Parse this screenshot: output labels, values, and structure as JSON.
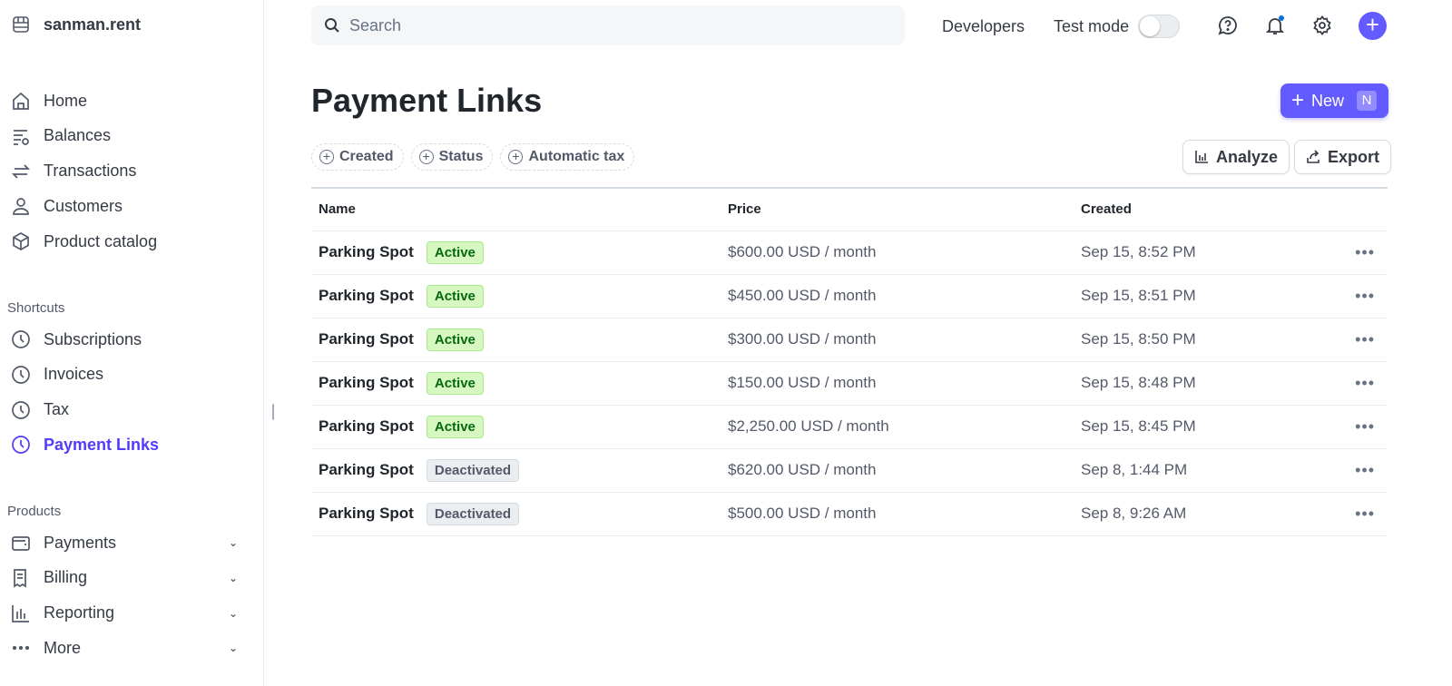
{
  "sidebar": {
    "account": "sanman.rent",
    "main": [
      {
        "label": "Home",
        "icon": "home-icon"
      },
      {
        "label": "Balances",
        "icon": "balances-icon"
      },
      {
        "label": "Transactions",
        "icon": "transactions-icon"
      },
      {
        "label": "Customers",
        "icon": "customer-icon"
      },
      {
        "label": "Product catalog",
        "icon": "box-icon"
      }
    ],
    "shortcuts_title": "Shortcuts",
    "shortcuts": [
      {
        "label": "Subscriptions"
      },
      {
        "label": "Invoices"
      },
      {
        "label": "Tax"
      },
      {
        "label": "Payment Links",
        "active": true
      }
    ],
    "products_title": "Products",
    "products": [
      {
        "label": "Payments"
      },
      {
        "label": "Billing"
      },
      {
        "label": "Reporting"
      },
      {
        "label": "More"
      }
    ]
  },
  "topbar": {
    "search_placeholder": "Search",
    "developers": "Developers",
    "test_mode": "Test mode",
    "test_mode_on": false
  },
  "page": {
    "title": "Payment Links",
    "new_label": "New",
    "new_shortcut": "N",
    "analyze": "Analyze",
    "export": "Export",
    "filters": [
      "Created",
      "Status",
      "Automatic tax"
    ]
  },
  "table": {
    "columns": [
      "Name",
      "Price",
      "Created"
    ],
    "rows": [
      {
        "name": "Parking Spot",
        "status": "Active",
        "price": "$600.00 USD / month",
        "created": "Sep 15, 8:52 PM"
      },
      {
        "name": "Parking Spot",
        "status": "Active",
        "price": "$450.00 USD / month",
        "created": "Sep 15, 8:51 PM"
      },
      {
        "name": "Parking Spot",
        "status": "Active",
        "price": "$300.00 USD / month",
        "created": "Sep 15, 8:50 PM"
      },
      {
        "name": "Parking Spot",
        "status": "Active",
        "price": "$150.00 USD / month",
        "created": "Sep 15, 8:48 PM"
      },
      {
        "name": "Parking Spot",
        "status": "Active",
        "price": "$2,250.00 USD / month",
        "created": "Sep 15, 8:45 PM"
      },
      {
        "name": "Parking Spot",
        "status": "Deactivated",
        "price": "$620.00 USD / month",
        "created": "Sep 8, 1:44 PM"
      },
      {
        "name": "Parking Spot",
        "status": "Deactivated",
        "price": "$500.00 USD / month",
        "created": "Sep 8, 9:26 AM"
      }
    ]
  },
  "colors": {
    "accent": "#635bff",
    "active_nav": "#533afd",
    "badge_active_bg": "#d7f7c2",
    "badge_active_text": "#05690d"
  }
}
